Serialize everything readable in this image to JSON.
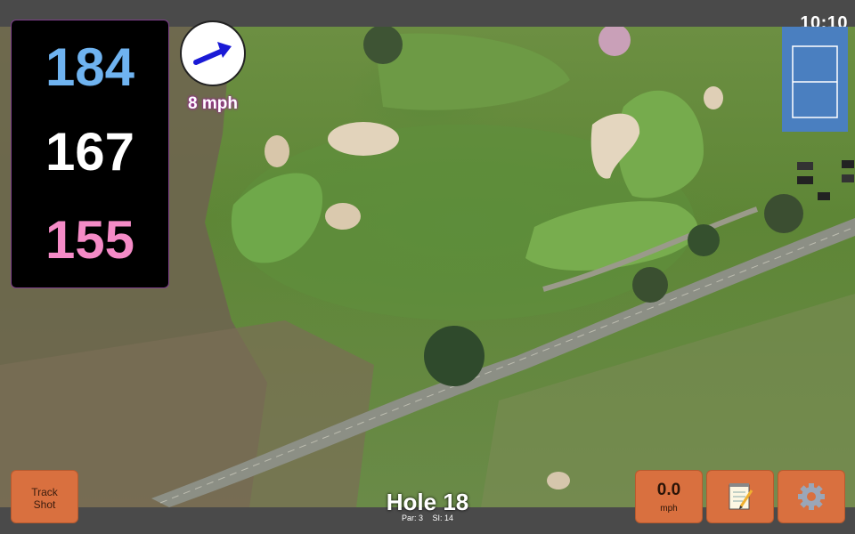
{
  "status": {
    "time": "10:10"
  },
  "yardages": {
    "back": "184",
    "middle": "167",
    "front": "155"
  },
  "wind": {
    "speed_label": "8 mph",
    "direction_icon": "wind-arrow-icon"
  },
  "hole": {
    "title": "Hole 18",
    "par": "Par: 3",
    "stroke_index": "SI: 14"
  },
  "buttons": {
    "track_shot_line1": "Track",
    "track_shot_line2": "Shot",
    "speed_value": "0.0",
    "speed_unit": "mph",
    "notes_icon": "notepad-icon",
    "settings_icon": "gear-icon"
  },
  "colors": {
    "back_yardage": "#6fb3f0",
    "middle_yardage": "#ffffff",
    "front_yardage": "#f58bc7",
    "button": "#d9703f",
    "wind_arrow": "#1a1ad6"
  }
}
